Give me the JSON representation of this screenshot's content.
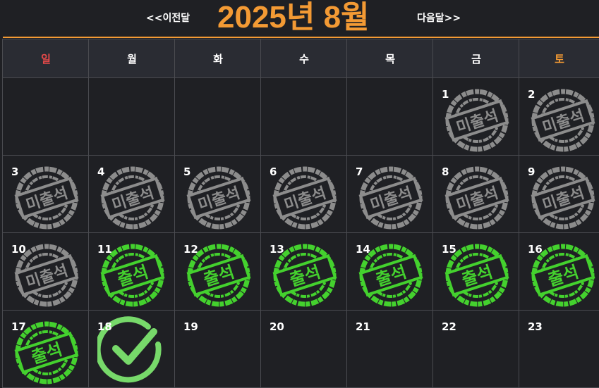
{
  "header": {
    "prev_label": "<<이전달",
    "title": "2025년 8월",
    "next_label": "다음달>>"
  },
  "colors": {
    "accent": "#f39a34",
    "sunday": "#e84a4a",
    "saturday": "#f39a34",
    "present_green": "#44d12e",
    "absent_gray": "#8c8c8c",
    "check_green": "#77d96a"
  },
  "weekdays": [
    "일",
    "월",
    "화",
    "수",
    "목",
    "금",
    "토"
  ],
  "stamps": {
    "absent_text": "미출석",
    "present_text": "출석"
  },
  "weeks": [
    [
      null,
      null,
      null,
      null,
      null,
      {
        "day": "1",
        "status": "absent"
      },
      {
        "day": "2",
        "status": "absent"
      }
    ],
    [
      {
        "day": "3",
        "status": "absent"
      },
      {
        "day": "4",
        "status": "absent"
      },
      {
        "day": "5",
        "status": "absent"
      },
      {
        "day": "6",
        "status": "absent"
      },
      {
        "day": "7",
        "status": "absent"
      },
      {
        "day": "8",
        "status": "absent"
      },
      {
        "day": "9",
        "status": "absent"
      }
    ],
    [
      {
        "day": "10",
        "status": "absent"
      },
      {
        "day": "11",
        "status": "present"
      },
      {
        "day": "12",
        "status": "present"
      },
      {
        "day": "13",
        "status": "present"
      },
      {
        "day": "14",
        "status": "present"
      },
      {
        "day": "15",
        "status": "present"
      },
      {
        "day": "16",
        "status": "present"
      }
    ],
    [
      {
        "day": "17",
        "status": "present"
      },
      {
        "day": "18",
        "status": "checked"
      },
      {
        "day": "19",
        "status": "none"
      },
      {
        "day": "20",
        "status": "none"
      },
      {
        "day": "21",
        "status": "none"
      },
      {
        "day": "22",
        "status": "none"
      },
      {
        "day": "23",
        "status": "none"
      }
    ]
  ]
}
